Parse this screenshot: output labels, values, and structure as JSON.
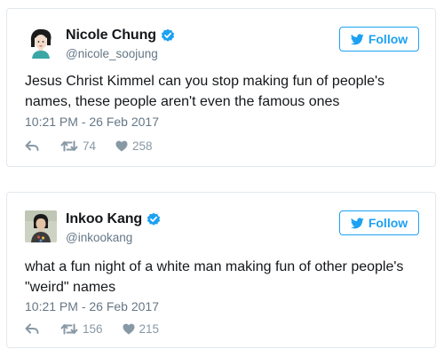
{
  "tweets": [
    {
      "display_name": "Nicole Chung",
      "handle": "@nicole_soojung",
      "verified": true,
      "follow_label": "Follow",
      "text": "Jesus Christ Kimmel can you stop making fun of people's names, these people aren't even the famous ones",
      "timestamp": "10:21 PM - 26 Feb 2017",
      "retweets": "74",
      "likes": "258",
      "avatar_icon": "illustrated-portrait-avatar"
    },
    {
      "display_name": "Inkoo Kang",
      "handle": "@inkookang",
      "verified": true,
      "follow_label": "Follow",
      "text": "what a fun night of a white man making fun of other people's \"weird\" names",
      "timestamp": "10:21 PM - 26 Feb 2017",
      "retweets": "156",
      "likes": "215",
      "avatar_icon": "photo-portrait-avatar"
    }
  ],
  "icons": {
    "verified": "verified-badge-icon",
    "bird": "twitter-bird-icon",
    "reply": "reply-icon",
    "retweet": "retweet-icon",
    "like": "heart-icon"
  },
  "colors": {
    "accent": "#1da1f2",
    "text": "#14171a",
    "secondary_text": "#657786",
    "action_gray": "#8899a6",
    "border": "#e1e8ed"
  }
}
